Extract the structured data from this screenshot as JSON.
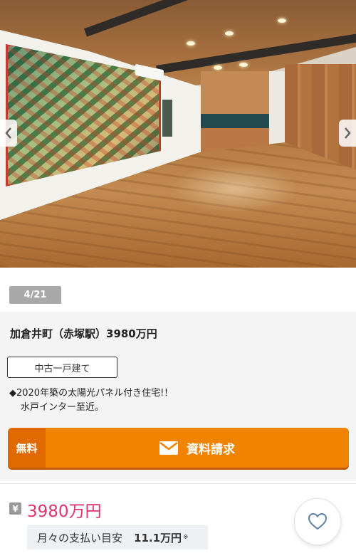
{
  "gallery": {
    "counter": "4/21",
    "prev_icon": "chevron-left-icon",
    "next_icon": "chevron-right-icon"
  },
  "listing": {
    "title": "加倉井町（赤塚駅）3980万円",
    "property_type": "中古一戸建て",
    "description_line1": "◆2020年築の太陽光パネル付き住宅!！",
    "description_line2": "水戸インター至近。"
  },
  "cta": {
    "free_label": "無料",
    "request_label": "資料請求",
    "icon": "mail-icon",
    "accent": "#f08300"
  },
  "price": {
    "currency_icon": "¥",
    "amount": "3980万円",
    "monthly_label": "月々の支払い目安",
    "monthly_value": "11.1万円",
    "monthly_note": "※",
    "price_color": "#e0336b"
  },
  "favorite": {
    "icon": "heart-icon"
  }
}
